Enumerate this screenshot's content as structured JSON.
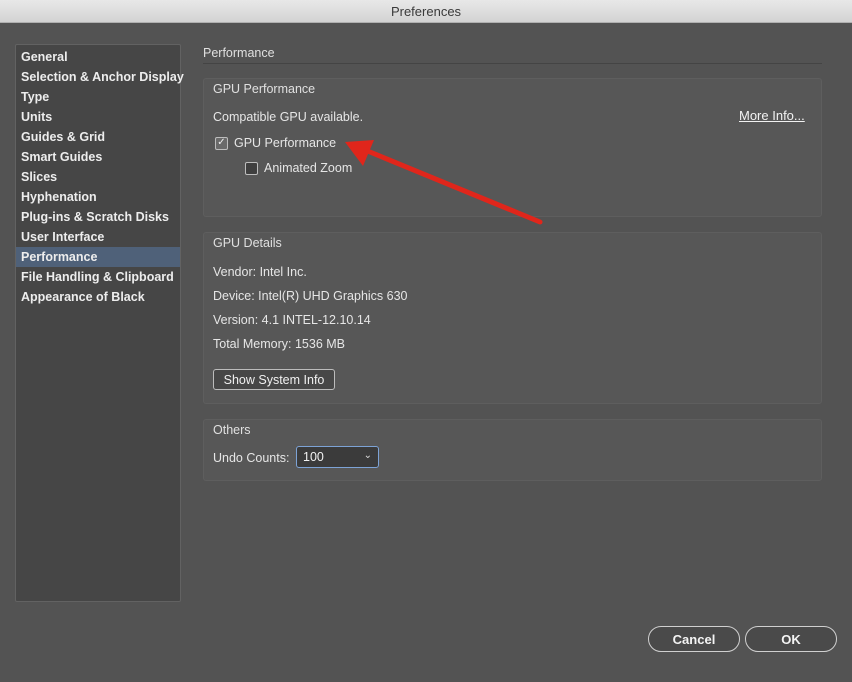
{
  "window": {
    "title": "Preferences"
  },
  "sidebar": {
    "items": [
      {
        "label": "General"
      },
      {
        "label": "Selection & Anchor Display"
      },
      {
        "label": "Type"
      },
      {
        "label": "Units"
      },
      {
        "label": "Guides & Grid"
      },
      {
        "label": "Smart Guides"
      },
      {
        "label": "Slices"
      },
      {
        "label": "Hyphenation"
      },
      {
        "label": "Plug-ins & Scratch Disks"
      },
      {
        "label": "User Interface"
      },
      {
        "label": "Performance",
        "selected": true
      },
      {
        "label": "File Handling & Clipboard"
      },
      {
        "label": "Appearance of Black"
      }
    ]
  },
  "main": {
    "section_title": "Performance",
    "gpu_performance": {
      "group_label": "GPU Performance",
      "status": "Compatible GPU available.",
      "more_info": "More Info...",
      "gpu_checkbox": {
        "label": "GPU Performance",
        "checked": true
      },
      "zoom_checkbox": {
        "label": "Animated Zoom",
        "checked": false
      }
    },
    "gpu_details": {
      "group_label": "GPU Details",
      "vendor": "Vendor: Intel Inc.",
      "device": "Device: Intel(R) UHD Graphics 630",
      "version": "Version: 4.1 INTEL-12.10.14",
      "memory": "Total Memory: 1536 MB",
      "show_system_info": "Show System Info"
    },
    "others": {
      "group_label": "Others",
      "undo_label": "Undo Counts:",
      "undo_value": "100"
    }
  },
  "footer": {
    "cancel": "Cancel",
    "ok": "OK"
  },
  "annotation": {
    "arrow_color": "#e0261b"
  },
  "icons": {
    "check": "checkmark-icon",
    "chevron": "chevron-down-icon"
  }
}
